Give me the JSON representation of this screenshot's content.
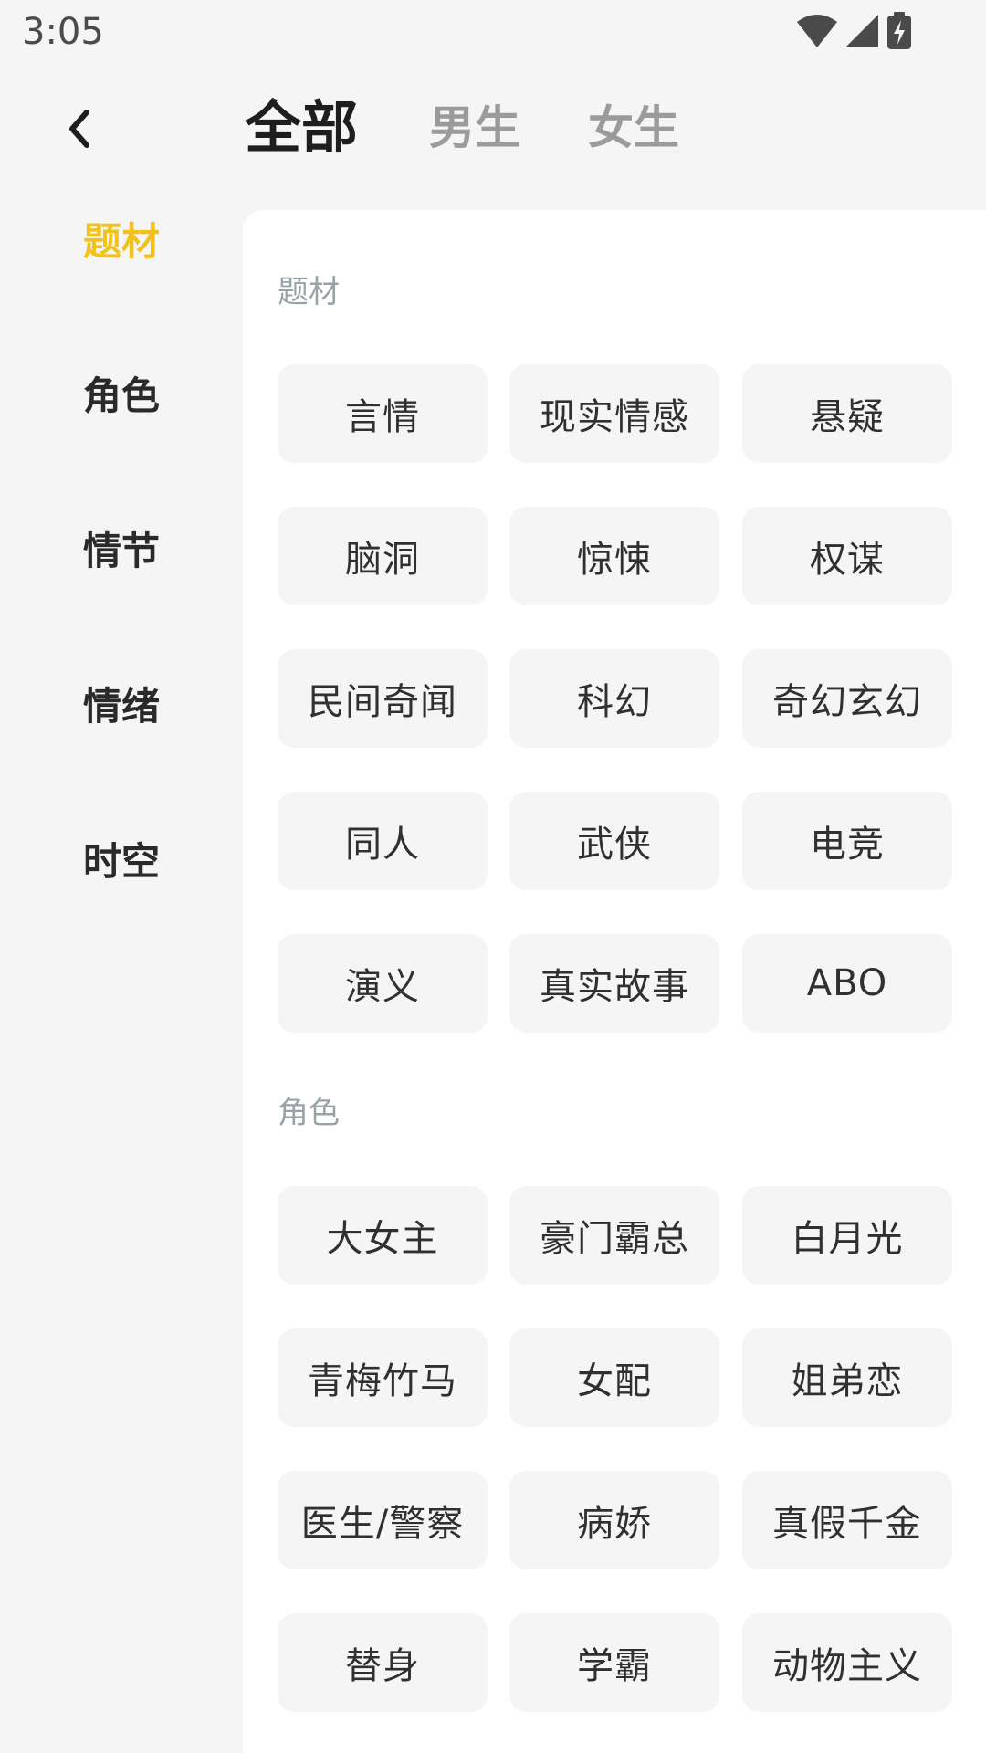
{
  "status_bar": {
    "time": "3:05",
    "icons": [
      "wifi-icon",
      "signal-icon",
      "battery-charging-icon"
    ]
  },
  "header": {
    "back_icon": "chevron-left-icon",
    "tabs": [
      {
        "label": "全部",
        "active": true
      },
      {
        "label": "男生",
        "active": false
      },
      {
        "label": "女生",
        "active": false
      }
    ]
  },
  "sidebar": {
    "items": [
      {
        "label": "题材",
        "active": true
      },
      {
        "label": "角色",
        "active": false
      },
      {
        "label": "情节",
        "active": false
      },
      {
        "label": "情绪",
        "active": false
      },
      {
        "label": "时空",
        "active": false
      }
    ]
  },
  "colors": {
    "accent": "#f2c21a",
    "background": "#f5f5f5",
    "panel": "#ffffff",
    "tag_bg": "#f5f5f5",
    "section_title": "#98a3a6"
  },
  "sections": [
    {
      "title": "题材",
      "tags": [
        "言情",
        "现实情感",
        "悬疑",
        "脑洞",
        "惊悚",
        "权谋",
        "民间奇闻",
        "科幻",
        "奇幻玄幻",
        "同人",
        "武侠",
        "电竞",
        "演义",
        "真实故事",
        "ABO"
      ]
    },
    {
      "title": "角色",
      "tags": [
        "大女主",
        "豪门霸总",
        "白月光",
        "青梅竹马",
        "女配",
        "姐弟恋",
        "医生/警察",
        "病娇",
        "真假千金",
        "替身",
        "学霸",
        "动物主义"
      ]
    }
  ]
}
